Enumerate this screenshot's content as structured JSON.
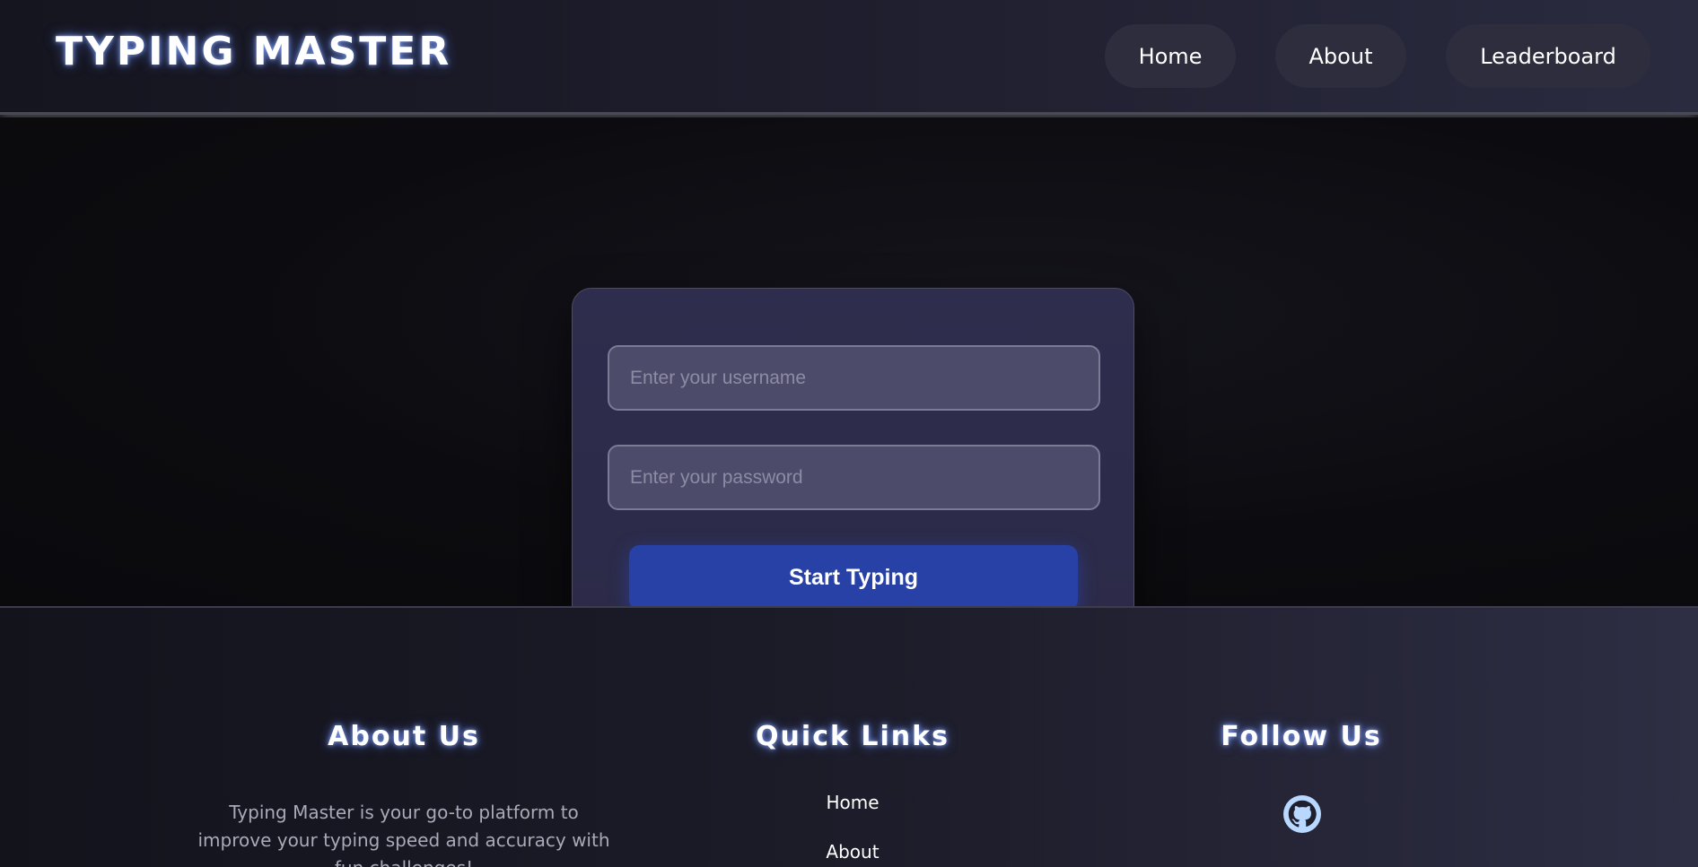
{
  "header": {
    "logo": "TYPING MASTER",
    "nav": {
      "home": "Home",
      "about": "About",
      "leaderboard": "Leaderboard"
    }
  },
  "login": {
    "username_placeholder": "Enter your username",
    "password_placeholder": "Enter your password",
    "submit_label": "Start Typing"
  },
  "footer": {
    "about": {
      "title": "About Us",
      "text": "Typing Master is your go-to platform to improve your typing speed and accuracy with fun challenges!"
    },
    "quick_links": {
      "title": "Quick Links",
      "items": [
        "Home",
        "About"
      ]
    },
    "follow": {
      "title": "Follow Us",
      "icon": "github-icon"
    }
  },
  "colors": {
    "accent": "#2741a6",
    "card": "#2e2d4d",
    "glow": "#8caaff"
  }
}
